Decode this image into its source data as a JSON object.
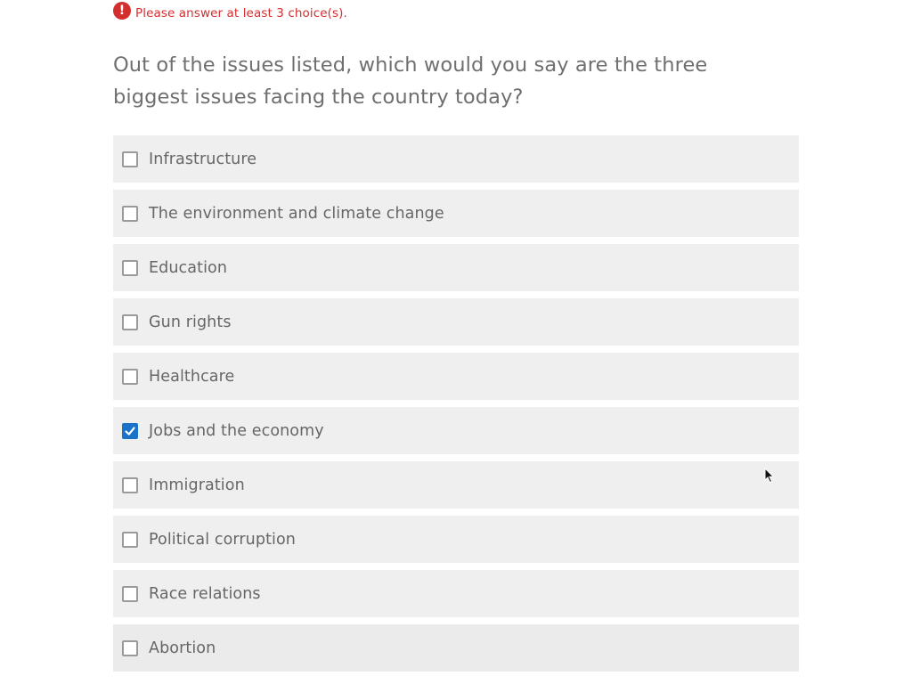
{
  "error": {
    "icon": "exclamation-circle-icon",
    "icon_glyph": "!",
    "message": "Please answer at least 3 choice(s)."
  },
  "question": {
    "text": "Out of the issues listed, which would you say are the three biggest issues facing the country today?"
  },
  "options": [
    {
      "label": "Infrastructure",
      "checked": false
    },
    {
      "label": "The environment and climate change",
      "checked": false
    },
    {
      "label": "Education",
      "checked": false
    },
    {
      "label": "Gun rights",
      "checked": false
    },
    {
      "label": "Healthcare",
      "checked": false
    },
    {
      "label": "Jobs and the economy",
      "checked": true
    },
    {
      "label": "Immigration",
      "checked": false
    },
    {
      "label": "Political corruption",
      "checked": false
    },
    {
      "label": "Race relations",
      "checked": false
    },
    {
      "label": "Abortion",
      "checked": false
    }
  ],
  "colors": {
    "error": "#d32f2f",
    "checked_box": "#1a73c8",
    "option_background": "#efefef",
    "text": "#666666"
  }
}
